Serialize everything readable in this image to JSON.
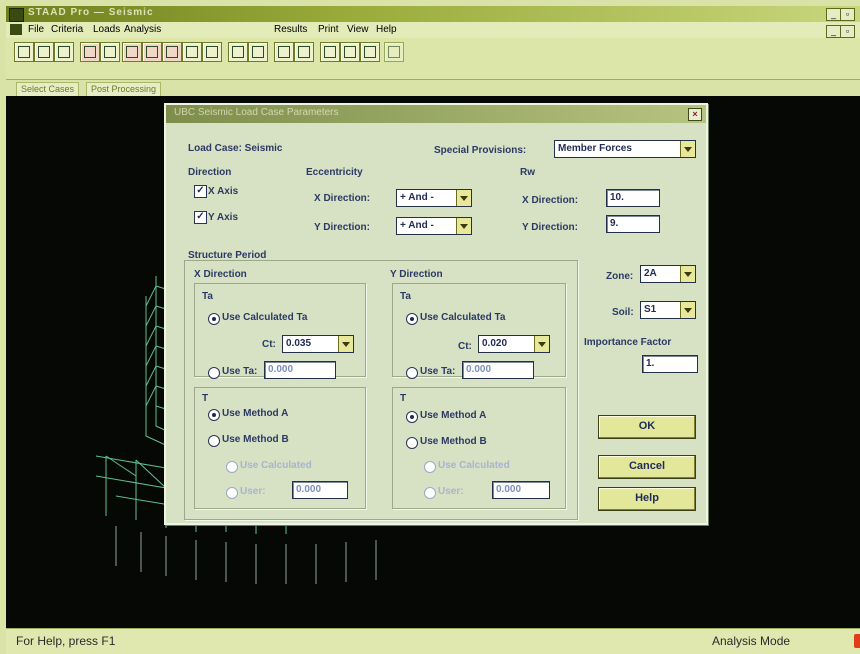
{
  "app": {
    "title": "STAAD Pro — Seismic",
    "status_left": "For Help, press F1",
    "status_right": "Analysis Mode"
  },
  "menu": [
    "File",
    "Criteria",
    "Loads",
    "Analysis",
    "Results",
    "Print",
    "View",
    "Help"
  ],
  "tabs": [
    "Select Cases",
    "Post Processing"
  ],
  "dialog": {
    "title": "UBC Seismic Load Case Parameters",
    "load_case_label": "Load Case: Seismic",
    "special_provisions_label": "Special Provisions:",
    "special_provisions_value": "Member Forces",
    "direction_label": "Direction",
    "x_axis_label": "X Axis",
    "y_axis_label": "Y Axis",
    "eccentricity_label": "Eccentricity",
    "ecc_x_label": "X Direction:",
    "ecc_x_value": "+ And -",
    "ecc_y_label": "Y Direction:",
    "ecc_y_value": "+ And -",
    "rw_label": "Rw",
    "rw_x_label": "X Direction:",
    "rw_x_value": "10.",
    "rw_y_label": "Y Direction:",
    "rw_y_value": "9.",
    "structure_period_label": "Structure Period",
    "x_dir": {
      "label": "X Direction",
      "ta_label": "Ta",
      "use_calc_label": "Use Calculated Ta",
      "ct_label": "Ct:",
      "ct_value": "0.035",
      "use_ta_label": "Use Ta:",
      "use_ta_value": "0.000",
      "t_label": "T",
      "method_a_label": "Use Method A",
      "method_b_label": "Use Method B",
      "calc_label": "Use Calculated",
      "user_label": "User:",
      "user_value": "0.000"
    },
    "y_dir": {
      "label": "Y Direction",
      "ta_label": "Ta",
      "use_calc_label": "Use Calculated Ta",
      "ct_label": "Ct:",
      "ct_value": "0.020",
      "use_ta_label": "Use Ta:",
      "use_ta_value": "0.000",
      "t_label": "T",
      "method_a_label": "Use Method A",
      "method_b_label": "Use Method B",
      "calc_label": "Use Calculated",
      "user_label": "User:",
      "user_value": "0.000"
    },
    "zone_label": "Zone:",
    "zone_value": "2A",
    "soil_label": "Soil:",
    "soil_value": "S1",
    "importance_label": "Importance Factor",
    "importance_value": "1.",
    "ok_label": "OK",
    "cancel_label": "Cancel",
    "help_label": "Help"
  }
}
